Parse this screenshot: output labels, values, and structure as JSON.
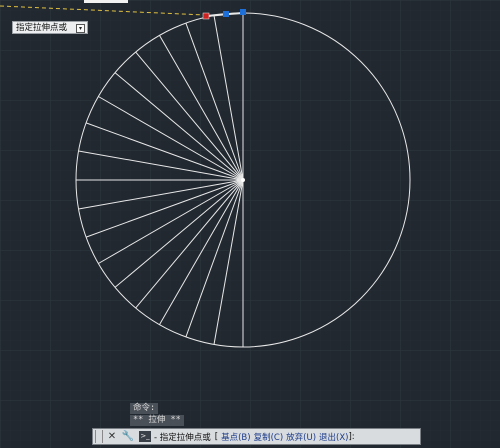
{
  "tooltip": {
    "text": "指定拉伸点或"
  },
  "history": {
    "line1": "命令:",
    "line2": "** 拉伸 **"
  },
  "command_line": {
    "prompt": "- 指定拉伸点或",
    "bracket_open": "[",
    "options": [
      "基点(B)",
      "复制(C)",
      "放弃(U)",
      "退出(X)"
    ],
    "bracket_close": "]:"
  },
  "icons": [
    "close-icon",
    "wrench-icon",
    "command-prompt-icon"
  ],
  "colors": {
    "background": "#212830",
    "grid_line": "#2c343d",
    "geometry": "#e8e8e8",
    "grip_selected": "#cc2222",
    "grip_hot": "#1e6fd8"
  }
}
